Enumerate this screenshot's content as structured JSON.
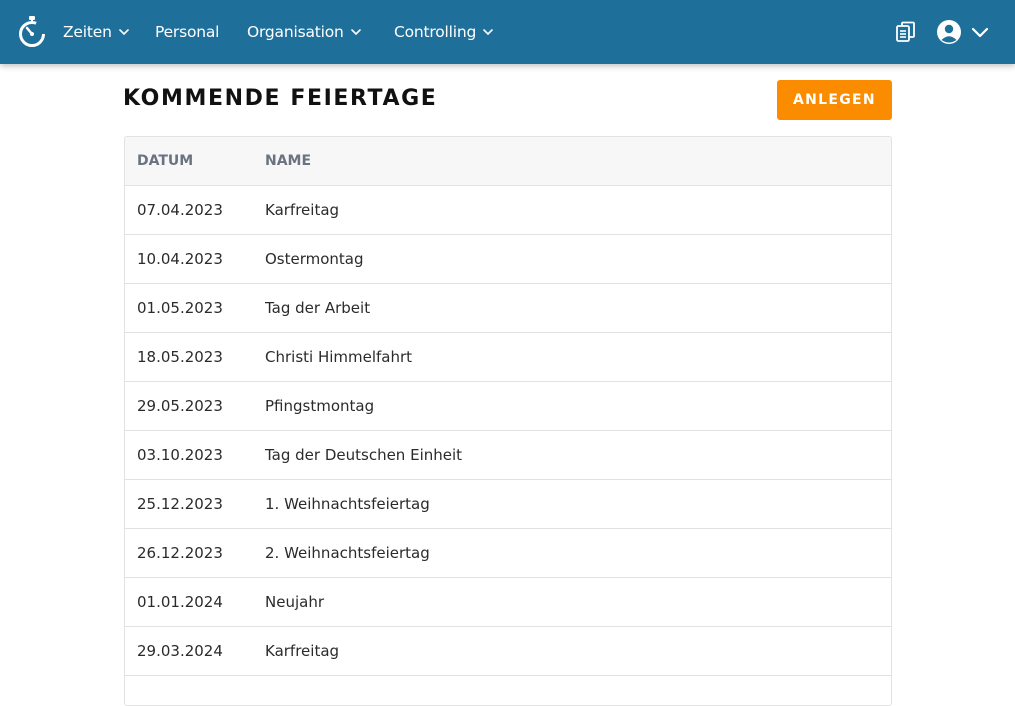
{
  "nav": {
    "zeiten": "Zeiten",
    "personal": "Personal",
    "organisation": "Organisation",
    "controlling": "Controlling"
  },
  "icons": {
    "logo": "stopwatch-logo-icon",
    "documents": "documents-icon",
    "avatar": "user-circle-icon",
    "dropdown": "chevron-down-icon"
  },
  "colors": {
    "navbar": "#1f6f9b",
    "accent": "#fb8c00"
  },
  "page": {
    "title": "KOMMENDE FEIERTAGE",
    "create_label": "ANLEGEN"
  },
  "table": {
    "columns": [
      "DATUM",
      "NAME"
    ],
    "rows": [
      {
        "date": "07.04.2023",
        "name": "Karfreitag"
      },
      {
        "date": "10.04.2023",
        "name": "Ostermontag"
      },
      {
        "date": "01.05.2023",
        "name": "Tag der Arbeit"
      },
      {
        "date": "18.05.2023",
        "name": "Christi Himmelfahrt"
      },
      {
        "date": "29.05.2023",
        "name": "Pfingstmontag"
      },
      {
        "date": "03.10.2023",
        "name": "Tag der Deutschen Einheit"
      },
      {
        "date": "25.12.2023",
        "name": "1. Weihnachtsfeiertag"
      },
      {
        "date": "26.12.2023",
        "name": "2. Weihnachtsfeiertag"
      },
      {
        "date": "01.01.2024",
        "name": "Neujahr"
      },
      {
        "date": "29.03.2024",
        "name": "Karfreitag"
      }
    ]
  }
}
